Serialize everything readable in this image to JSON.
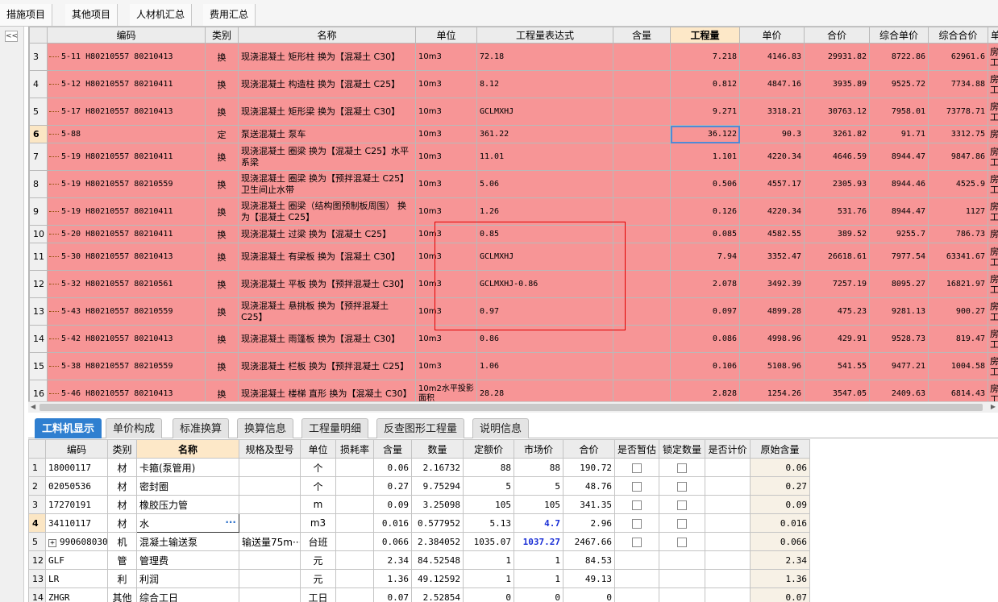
{
  "top_tabs": [
    "措施项目",
    "其他项目",
    "人材机汇总",
    "费用汇总"
  ],
  "sidebar": {
    "collapse_label": "<<"
  },
  "main_grid": {
    "columns": [
      "",
      "编码",
      "类别",
      "名称",
      "单位",
      "工程量表达式",
      "含量",
      "工程量",
      "单价",
      "合价",
      "综合单价",
      "综合合价",
      "单"
    ],
    "rows": [
      {
        "n": "3",
        "code": "5-11 H80210557 80210413",
        "cat": "换",
        "name": "现浇混凝土 矩形柱  换为【混凝土 C30】",
        "unit": "10m3",
        "expr": "72.18",
        "qty": "7.218",
        "price": "4146.83",
        "total": "29931.82",
        "cprice": "8722.86",
        "ctotal": "62961.6",
        "last": "房工"
      },
      {
        "n": "4",
        "code": "5-12 H80210557 80210411",
        "cat": "换",
        "name": "现浇混凝土 构造柱  换为【混凝土 C25】",
        "unit": "10m3",
        "expr": "8.12",
        "qty": "0.812",
        "price": "4847.16",
        "total": "3935.89",
        "cprice": "9525.72",
        "ctotal": "7734.88",
        "last": "房工"
      },
      {
        "n": "5",
        "code": "5-17 H80210557 80210413",
        "cat": "换",
        "name": "现浇混凝土 矩形梁  换为【混凝土 C30】",
        "unit": "10m3",
        "expr": "GCLMXHJ",
        "qty": "9.271",
        "price": "3318.21",
        "total": "30763.12",
        "cprice": "7958.01",
        "ctotal": "73778.71",
        "last": "房工"
      },
      {
        "n": "6",
        "code": "5-88",
        "cat": "定",
        "name": "泵送混凝土 泵车",
        "unit": "10m3",
        "expr": "361.22",
        "qty": "36.122",
        "price": "90.3",
        "total": "3261.82",
        "cprice": "91.71",
        "ctotal": "3312.75",
        "last": "房"
      },
      {
        "n": "7",
        "code": "5-19 H80210557 80210411",
        "cat": "换",
        "name": "现浇混凝土 圈梁  换为【混凝土 C25】水平系梁",
        "unit": "10m3",
        "expr": "11.01",
        "qty": "1.101",
        "price": "4220.34",
        "total": "4646.59",
        "cprice": "8944.47",
        "ctotal": "9847.86",
        "last": "房工"
      },
      {
        "n": "8",
        "code": "5-19 H80210557 80210559",
        "cat": "换",
        "name": "现浇混凝土 圈梁  换为【预拌混凝土 C25】  卫生间止水带",
        "unit": "10m3",
        "expr": "5.06",
        "qty": "0.506",
        "price": "4557.17",
        "total": "2305.93",
        "cprice": "8944.46",
        "ctotal": "4525.9",
        "last": "房工"
      },
      {
        "n": "9",
        "code": "5-19 H80210557 80210411",
        "cat": "换",
        "name": "现浇混凝土 圈梁（结构图预制板周围） 换为【混凝土 C25】",
        "unit": "10m3",
        "expr": "1.26",
        "qty": "0.126",
        "price": "4220.34",
        "total": "531.76",
        "cprice": "8944.47",
        "ctotal": "1127",
        "last": "房工"
      },
      {
        "n": "10",
        "code": "5-20 H80210557 80210411",
        "cat": "换",
        "name": "现浇混凝土 过梁  换为【混凝土 C25】",
        "unit": "10m3",
        "expr": "0.85",
        "qty": "0.085",
        "price": "4582.55",
        "total": "389.52",
        "cprice": "9255.7",
        "ctotal": "786.73",
        "last": "房"
      },
      {
        "n": "11",
        "code": "5-30 H80210557 80210413",
        "cat": "换",
        "name": "现浇混凝土 有梁板  换为【混凝土 C30】",
        "unit": "10m3",
        "expr": "GCLMXHJ",
        "qty": "7.94",
        "price": "3352.47",
        "total": "26618.61",
        "cprice": "7977.54",
        "ctotal": "63341.67",
        "last": "房工"
      },
      {
        "n": "12",
        "code": "5-32 H80210557 80210561",
        "cat": "换",
        "name": "现浇混凝土 平板  换为【预拌混凝土 C30】",
        "unit": "10m3",
        "expr": "GCLMXHJ-0.86",
        "qty": "2.078",
        "price": "3492.39",
        "total": "7257.19",
        "cprice": "8095.27",
        "ctotal": "16821.97",
        "last": "房工"
      },
      {
        "n": "13",
        "code": "5-43 H80210557 80210559",
        "cat": "换",
        "name": "现浇混凝土 悬挑板  换为【预拌混凝土 C25】",
        "unit": "10m3",
        "expr": "0.97",
        "qty": "0.097",
        "price": "4899.28",
        "total": "475.23",
        "cprice": "9281.13",
        "ctotal": "900.27",
        "last": "房工"
      },
      {
        "n": "14",
        "code": "5-42 H80210557 80210413",
        "cat": "换",
        "name": "现浇混凝土 雨篷板  换为【混凝土 C30】",
        "unit": "10m3",
        "expr": "0.86",
        "qty": "0.086",
        "price": "4998.96",
        "total": "429.91",
        "cprice": "9528.73",
        "ctotal": "819.47",
        "last": "房工"
      },
      {
        "n": "15",
        "code": "5-38 H80210557 80210559",
        "cat": "换",
        "name": "现浇混凝土 栏板  换为【预拌混凝土 C25】",
        "unit": "10m3",
        "expr": "1.06",
        "qty": "0.106",
        "price": "5108.96",
        "total": "541.55",
        "cprice": "9477.21",
        "ctotal": "1004.58",
        "last": "房工"
      },
      {
        "n": "16",
        "code": "5-46 H80210557 80210413",
        "cat": "换",
        "name": "现浇混凝土 楼梯 直形  换为【混凝土 C30】",
        "unit": "10m2水平投影面积",
        "expr": "28.28",
        "qty": "2.828",
        "price": "1254.26",
        "total": "3547.05",
        "cprice": "2409.63",
        "ctotal": "6814.43",
        "last": "房工"
      }
    ]
  },
  "bottom_tabs": [
    "工料机显示",
    "单价构成",
    "标准换算",
    "换算信息",
    "工程量明细",
    "反查图形工程量",
    "说明信息"
  ],
  "bottom_grid": {
    "columns": [
      "",
      "编码",
      "类别",
      "名称",
      "规格及型号",
      "单位",
      "损耗率",
      "含量",
      "数量",
      "定额价",
      "市场价",
      "合价",
      "是否暂估",
      "锁定数量",
      "是否计价",
      "原始含量"
    ],
    "rows": [
      {
        "n": "1",
        "code": "18000117",
        "cat": "材",
        "name": "卡箍(泵管用)",
        "spec": "",
        "unit": "个",
        "loss": "",
        "content": "0.06",
        "qty": "2.16732",
        "dprice": "88",
        "mprice": "88",
        "total": "190.72",
        "orig": "0.06"
      },
      {
        "n": "2",
        "code": "02050536",
        "cat": "材",
        "name": "密封圈",
        "spec": "",
        "unit": "个",
        "loss": "",
        "content": "0.27",
        "qty": "9.75294",
        "dprice": "5",
        "mprice": "5",
        "total": "48.76",
        "orig": "0.27"
      },
      {
        "n": "3",
        "code": "17270191",
        "cat": "材",
        "name": "橡胶压力管",
        "spec": "",
        "unit": "m",
        "loss": "",
        "content": "0.09",
        "qty": "3.25098",
        "dprice": "105",
        "mprice": "105",
        "total": "341.35",
        "orig": "0.09"
      },
      {
        "n": "4",
        "code": "34110117",
        "cat": "材",
        "name": "水",
        "spec": "",
        "unit": "m3",
        "loss": "",
        "content": "0.016",
        "qty": "0.577952",
        "dprice": "5.13",
        "mprice": "4.7",
        "total": "2.96",
        "orig": "0.016"
      },
      {
        "n": "5",
        "code": "990608030",
        "cat": "机",
        "name": "混凝土输送泵",
        "spec": "输送量75m···",
        "unit": "台班",
        "loss": "",
        "content": "0.066",
        "qty": "2.384052",
        "dprice": "1035.07",
        "mprice": "1037.27",
        "total": "2467.66",
        "orig": "0.066"
      },
      {
        "n": "12",
        "code": "GLF",
        "cat": "管",
        "name": "管理费",
        "spec": "",
        "unit": "元",
        "loss": "",
        "content": "2.34",
        "qty": "84.52548",
        "dprice": "1",
        "mprice": "1",
        "total": "84.53",
        "orig": "2.34"
      },
      {
        "n": "13",
        "code": "LR",
        "cat": "利",
        "name": "利润",
        "spec": "",
        "unit": "元",
        "loss": "",
        "content": "1.36",
        "qty": "49.12592",
        "dprice": "1",
        "mprice": "1",
        "total": "49.13",
        "orig": "1.36"
      },
      {
        "n": "14",
        "code": "ZHGR",
        "cat": "其他",
        "name": "综合工日",
        "spec": "",
        "unit": "工日",
        "loss": "",
        "content": "0.07",
        "qty": "2.52854",
        "dprice": "0",
        "mprice": "0",
        "total": "0",
        "orig": "0.07"
      }
    ],
    "edit_dots": "···",
    "expand_symbol": "+"
  },
  "colors": {
    "row_pink": "#f79596",
    "tab_active": "#2f7fd0",
    "highlight_box": "#e00000",
    "selection_blue": "#4f8ad6"
  }
}
